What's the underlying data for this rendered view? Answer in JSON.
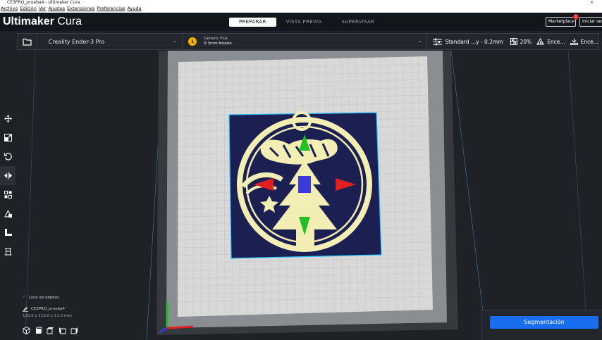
{
  "window": {
    "title": "CE3PRO_prueba4 - Ultimaker Cura",
    "close_glyph": "×"
  },
  "menu": [
    "Archivo",
    "Edición",
    "Ver",
    "Ajustes",
    "Extensiones",
    "Preferencias",
    "Ayuda"
  ],
  "brand": {
    "bold": "Ultimaker",
    "light": "Cura"
  },
  "stages": [
    {
      "label": "PREPARAR",
      "active": true
    },
    {
      "label": "VISTA PREVIA",
      "active": false
    },
    {
      "label": "SUPERVISAR",
      "active": false
    }
  ],
  "header_buttons": {
    "marketplace": "Marketplace",
    "marketplace_badge": "1",
    "login": "Iniciar sesión"
  },
  "toolbar": {
    "printer": "Creality Ender-3 Pro",
    "material_badge": "1",
    "material": "Generic PLA",
    "nozzle": "0.3mm Nozzle",
    "profile": "Standard ...y - 0.2mm",
    "infill": "20%",
    "support": "Ence...",
    "adhesion": "Ence..."
  },
  "tools": [
    "move-icon",
    "scale-icon",
    "rotate-icon",
    "mirror-icon",
    "per-model-settings-icon",
    "support-blocker-icon",
    "lay-flat-icon",
    "custom-support-icon"
  ],
  "active_tool": "mirror-icon",
  "object_list": {
    "header": "Lista de objetos",
    "object_name": "CE3PRO_prueba4",
    "dimensions": "120.0 x 115.0 x 11.0 mm"
  },
  "slice_button": "Segmentación",
  "colors": {
    "accent_blue": "#196ef0",
    "plate": "#d9d9d9",
    "model": "#f3efb4",
    "model_base": "#1b1f52",
    "selection": "#25c2ff",
    "axis_x": "#e02020",
    "axis_y": "#20c020",
    "axis_z": "#3a3ad8"
  }
}
